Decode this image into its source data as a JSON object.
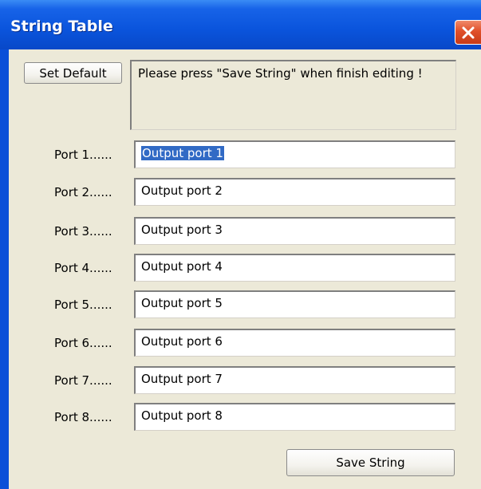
{
  "window": {
    "title": "String Table",
    "close_icon": "close-icon"
  },
  "toolbar": {
    "set_default_label": "Set Default",
    "message": "Please press \"Save String\" when finish editing !"
  },
  "ports": [
    {
      "label": "Port 1......",
      "value": "Output port 1"
    },
    {
      "label": "Port 2......",
      "value": "Output port 2"
    },
    {
      "label": "Port 3......",
      "value": "Output port 3"
    },
    {
      "label": "Port 4......",
      "value": "Output port 4"
    },
    {
      "label": "Port 5......",
      "value": "Output port 5"
    },
    {
      "label": "Port 6......",
      "value": "Output port 6"
    },
    {
      "label": "Port 7......",
      "value": "Output port 7"
    },
    {
      "label": "Port 8......",
      "value": "Output port 8"
    }
  ],
  "footer": {
    "save_label": "Save String"
  },
  "colors": {
    "titlebar": "#0a54dc",
    "client": "#ece9d8",
    "selection": "#316ac5"
  }
}
